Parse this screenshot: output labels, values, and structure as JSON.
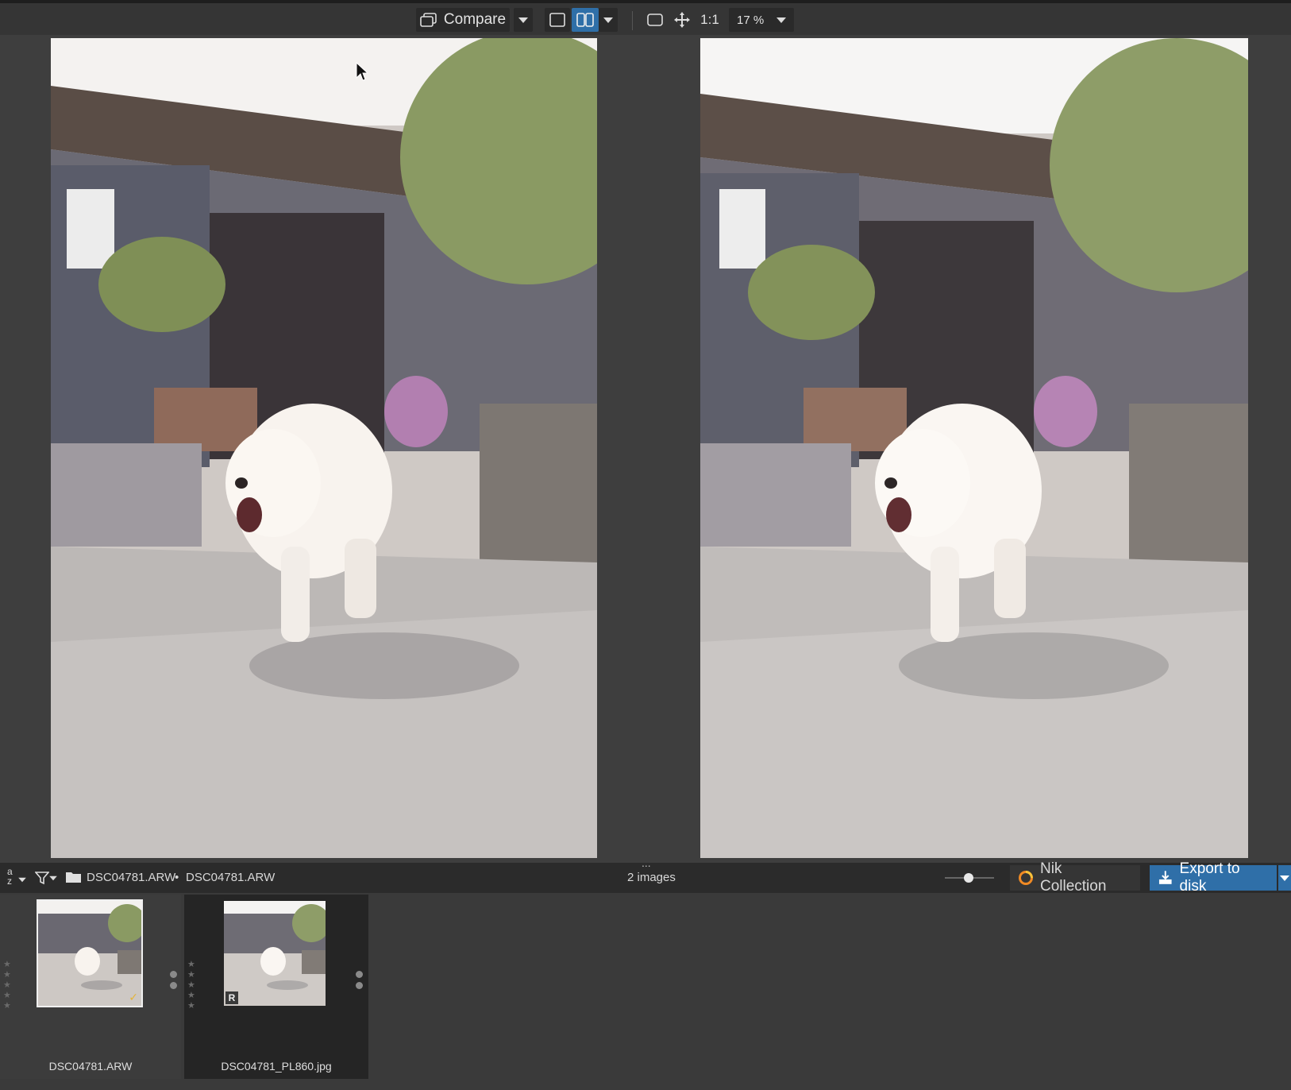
{
  "toolbar": {
    "compare_label": "Compare",
    "ratio_label": "1:1",
    "zoom_value": "17 %",
    "icons": [
      "compare-icon",
      "single-view-icon",
      "side-by-side-icon",
      "fit-screen-icon",
      "pan-move-icon"
    ]
  },
  "status_bar": {
    "sort_label_a": "a",
    "sort_label_z": "z",
    "breadcrumb_folder": "DSC04781.ARW",
    "breadcrumb_separator": "•",
    "breadcrumb_file": "DSC04781.ARW",
    "image_count": "2 images",
    "handle_dots": "...",
    "nik_label": "Nik Collection",
    "export_label": "Export to disk",
    "accent_color": "#2f6fa8"
  },
  "filmstrip": {
    "items": [
      {
        "filename": "DSC04781.ARW",
        "selected": true,
        "badge": "✓"
      },
      {
        "filename": "DSC04781_PL860.jpg",
        "selected": false,
        "badge": "R"
      }
    ],
    "star_glyph": "★"
  }
}
